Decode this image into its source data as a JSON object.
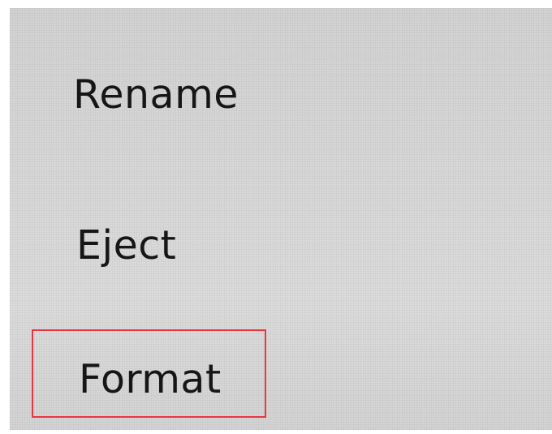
{
  "menu": {
    "items": [
      {
        "label": "Rename"
      },
      {
        "label": "Eject"
      },
      {
        "label": "Format",
        "highlighted": true
      }
    ],
    "highlight_color": "#e8353f"
  }
}
